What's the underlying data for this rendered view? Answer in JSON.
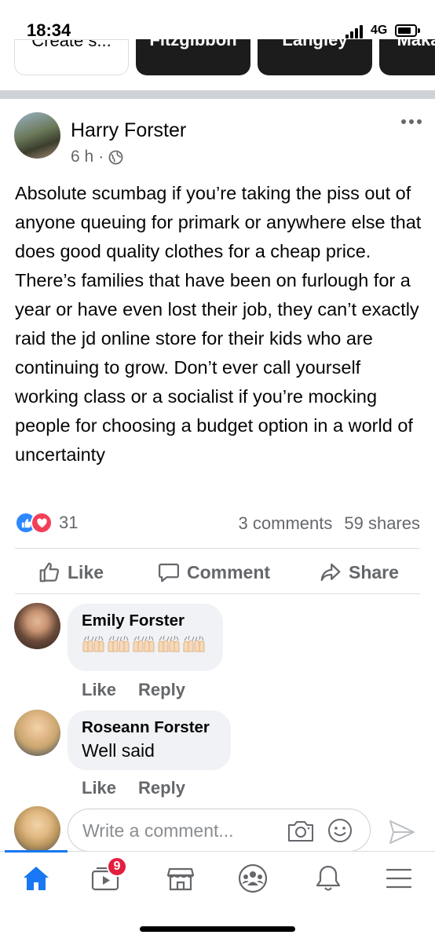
{
  "status_bar": {
    "time": "18:34",
    "network": "4G"
  },
  "stories": [
    {
      "label": "Create s...",
      "style": "light"
    },
    {
      "label": "Fitzgibbon",
      "style": "dark"
    },
    {
      "label": "Langley",
      "style": "dark"
    },
    {
      "label": "Maka",
      "style": "dark"
    }
  ],
  "post": {
    "author": "Harry Forster",
    "time": "6 h",
    "separator": "·",
    "privacy_icon": "globe-icon",
    "text": "Absolute scumbag if you’re taking the piss out of anyone queuing for primark or anywhere else that does good quality clothes for a cheap price. There’s families that have been on furlough for a year or have even lost their job, they can’t exactly raid the jd online store for their kids who are continuing to grow. Don’t ever call yourself working class or a socialist if you’re mocking people for choosing a budget option in a world of uncertainty",
    "reaction_count": "31",
    "comments_count": "3 comments",
    "shares_count": "59 shares"
  },
  "actions": {
    "like": "Like",
    "comment": "Comment",
    "share": "Share"
  },
  "comments": [
    {
      "name": "Emily Forster",
      "text": "",
      "emoji_count": 5,
      "like": "Like",
      "reply": "Reply"
    },
    {
      "name": "Roseann Forster",
      "text": "Well said",
      "like": "Like",
      "reply": "Reply"
    }
  ],
  "composer": {
    "placeholder": "Write a comment..."
  },
  "tabbar": {
    "video_badge": "9",
    "active_color": "#1877f2"
  }
}
